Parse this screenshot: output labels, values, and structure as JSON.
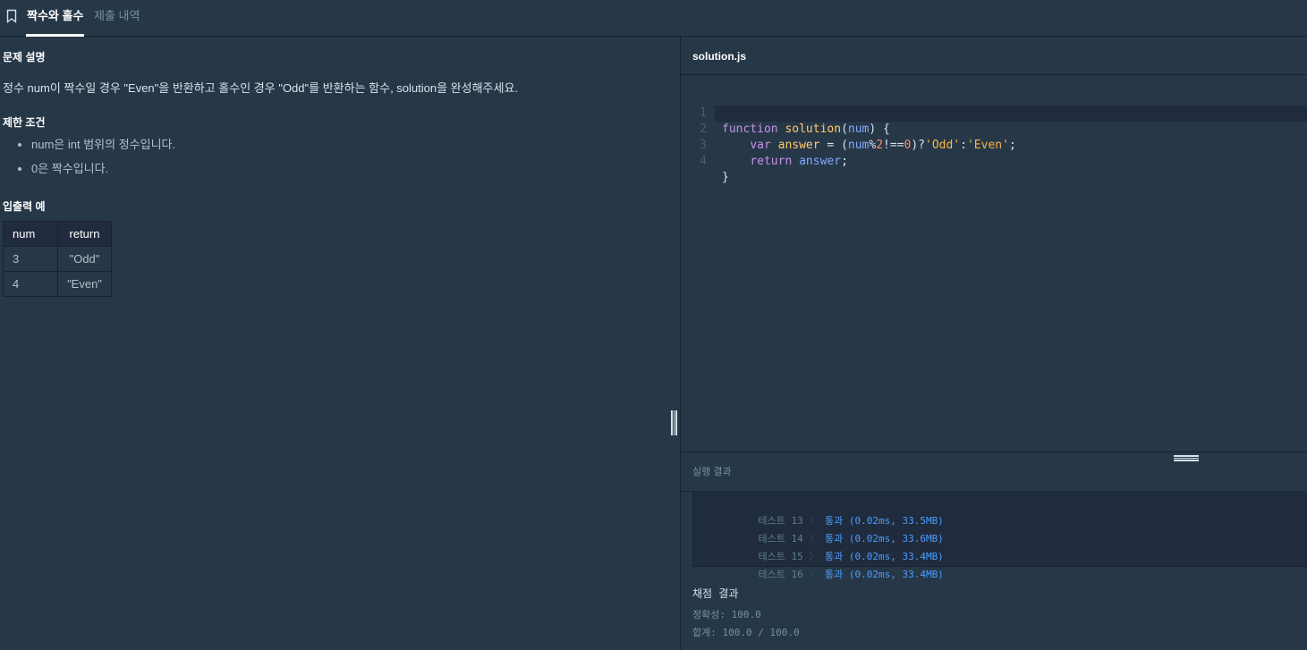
{
  "tabs": [
    {
      "label": "짝수와 홀수",
      "active": true
    },
    {
      "label": "제출 내역",
      "active": false
    }
  ],
  "problem": {
    "description_title": "문제 설명",
    "description": "정수 num이 짝수일 경우 \"Even\"을 반환하고 홀수인 경우 \"Odd\"를 반환하는 함수, solution을 완성해주세요.",
    "constraints_title": "제한 조건",
    "constraints": [
      "num은 int 범위의 정수입니다.",
      "0은 짝수입니다."
    ],
    "examples_title": "입출력 예",
    "examples": {
      "headers": [
        "num",
        "return"
      ],
      "rows": [
        [
          "3",
          "\"Odd\""
        ],
        [
          "4",
          "\"Even\""
        ]
      ]
    }
  },
  "editor": {
    "filename": "solution.js",
    "line_numbers": [
      "1",
      "2",
      "3",
      "4"
    ],
    "active_line": 2
  },
  "result": {
    "title": "실행 결과",
    "tests": [
      {
        "label": "테스트 13",
        "arrow": "〉",
        "result": "통과 (0.02ms, 33.5MB)"
      },
      {
        "label": "테스트 14",
        "arrow": "〉",
        "result": "통과 (0.02ms, 33.6MB)"
      },
      {
        "label": "테스트 15",
        "arrow": "〉",
        "result": "통과 (0.02ms, 33.4MB)"
      },
      {
        "label": "테스트 16",
        "arrow": "〉",
        "result": "통과 (0.02ms, 33.4MB)"
      }
    ],
    "grade_title": "채점 결과",
    "accuracy": "정확성: 100.0",
    "total": "합계: 100.0 / 100.0"
  },
  "colors": {
    "background": "#263747",
    "panel_dark": "#202b3d",
    "pass": "#4a9eff"
  }
}
